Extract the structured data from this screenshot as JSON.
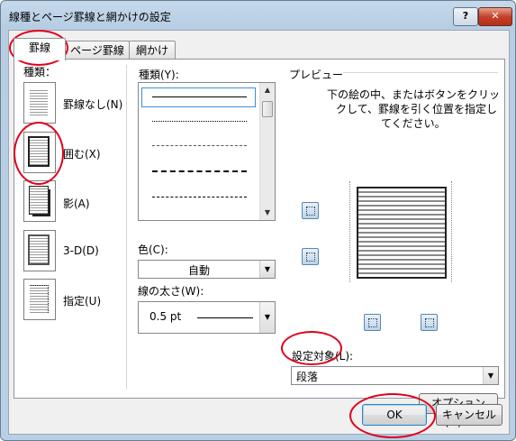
{
  "window": {
    "title": "線種とページ罫線と網かけの設定",
    "help_label": "?",
    "close_label": "✕"
  },
  "tabs": [
    {
      "label": "罫線",
      "active": true
    },
    {
      "label": "ページ罫線",
      "active": false
    },
    {
      "label": "網かけ",
      "active": false
    }
  ],
  "setting": {
    "heading": "種類：",
    "items": [
      {
        "label": "罫線なし(N)",
        "icon": "no-border-icon"
      },
      {
        "label": "囲む(X)",
        "icon": "box-border-icon"
      },
      {
        "label": "影(A)",
        "icon": "shadow-border-icon"
      },
      {
        "label": "3-D(D)",
        "icon": "3d-border-icon"
      },
      {
        "label": "指定(U)",
        "icon": "custom-border-icon"
      }
    ]
  },
  "style": {
    "heading": "種類(Y):",
    "line_styles": [
      "solid",
      "dotted",
      "dashed-fine",
      "dashed",
      "dash-dot"
    ],
    "color_label": "色(C):",
    "color_value": "自動",
    "width_label": "線の太さ(W):",
    "width_value": "0.5 pt"
  },
  "preview": {
    "heading": "プレビュー",
    "instruction_line1": "下の絵の中、またはボタンをクリッ",
    "instruction_line2": "クして、罫線を引く位置を指定し",
    "instruction_line3": "てください。"
  },
  "apply_to": {
    "label": "設定対象(L):",
    "value": "段落"
  },
  "buttons": {
    "options": "オプション(O)...",
    "ok": "OK",
    "cancel": "キャンセル"
  }
}
